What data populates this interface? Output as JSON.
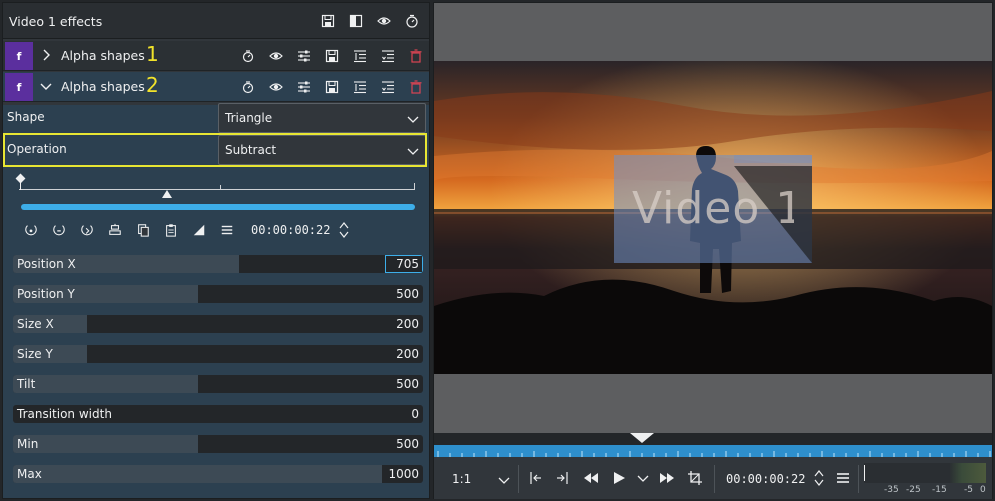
{
  "panel": {
    "title": "Video 1 effects",
    "header_icons": [
      "save-icon",
      "split-compare-icon",
      "eye-icon",
      "timer-icon"
    ]
  },
  "effects": [
    {
      "badge": "f",
      "name": "Alpha shapes",
      "annotation": "1",
      "expanded": false,
      "icons": [
        "timer-icon",
        "eye-icon",
        "sliders-icon",
        "save-icon",
        "collapse-all-icon",
        "expand-all-icon",
        "delete-icon"
      ]
    },
    {
      "badge": "f",
      "name": "Alpha shapes",
      "annotation": "2",
      "expanded": true,
      "icons": [
        "timer-icon",
        "eye-icon",
        "sliders-icon",
        "save-icon",
        "collapse-all-icon",
        "expand-all-icon",
        "delete-icon"
      ]
    }
  ],
  "properties": {
    "shape": {
      "label": "Shape",
      "value": "Triangle"
    },
    "operation": {
      "label": "Operation",
      "value": "Subtract"
    }
  },
  "keyframes": {
    "timecode": "00:00:00:22",
    "toolbar_icons": [
      "add-keyframe-icon",
      "remove-keyframe-icon",
      "move-keyframe-icon",
      "align-icon",
      "copy-icon",
      "paste-icon",
      "interpolation-icon",
      "menu-icon"
    ]
  },
  "params": [
    {
      "label": "Position X",
      "value": "705",
      "fill": 0.55,
      "editing": true
    },
    {
      "label": "Position Y",
      "value": "500",
      "fill": 0.45
    },
    {
      "label": "Size X",
      "value": "200",
      "fill": 0.18
    },
    {
      "label": "Size Y",
      "value": "200",
      "fill": 0.18
    },
    {
      "label": "Tilt",
      "value": "500",
      "fill": 0.45
    },
    {
      "label": "Transition width",
      "value": "0",
      "fill": 0.0
    },
    {
      "label": "Min",
      "value": "500",
      "fill": 0.45
    },
    {
      "label": "Max",
      "value": "1000",
      "fill": 0.9
    }
  ],
  "monitor": {
    "overlay_text": "Video 1",
    "zoom": "1:1",
    "timecode": "00:00:00:22",
    "meter_labels": [
      "-35",
      "-25",
      "-15",
      "-5",
      "0"
    ]
  },
  "colors": {
    "accent": "#3daee9",
    "highlight": "#e8e633",
    "annotation": "#f2e32a",
    "effect_badge": "#5b2f9e",
    "delete": "#da4453"
  }
}
